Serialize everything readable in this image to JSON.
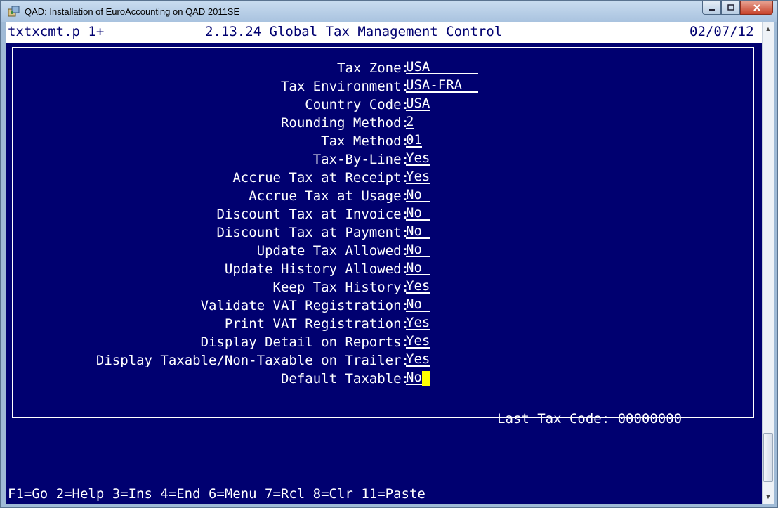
{
  "window": {
    "title": "QAD: Installation of EuroAccounting on QAD 2011SE",
    "icon": "qad-app-icon"
  },
  "header": {
    "program": "txtxcmt.p 1+",
    "menu_title": "2.13.24 Global Tax Management Control",
    "date": "02/07/12"
  },
  "fields": [
    {
      "label": "Tax Zone:",
      "value": "USA"
    },
    {
      "label": "Tax Environment:",
      "value": "USA-FRA"
    },
    {
      "label": "Country Code:",
      "value": "USA"
    },
    {
      "label": "Rounding Method:",
      "value": "2"
    },
    {
      "label": "Tax Method:",
      "value": "01"
    },
    {
      "label": "Tax-By-Line:",
      "value": "Yes"
    },
    {
      "label": "Accrue Tax at Receipt:",
      "value": "Yes"
    },
    {
      "label": "Accrue Tax at Usage:",
      "value": "No"
    },
    {
      "label": "Discount Tax at Invoice:",
      "value": "No"
    },
    {
      "label": "Discount Tax at Payment:",
      "value": "No"
    },
    {
      "label": "Update Tax Allowed:",
      "value": "No"
    },
    {
      "label": "Update History Allowed:",
      "value": "No"
    },
    {
      "label": "Keep Tax History:",
      "value": "Yes"
    },
    {
      "label": "Validate VAT Registration:",
      "value": "No"
    },
    {
      "label": "Print VAT Registration:",
      "value": "Yes"
    },
    {
      "label": "Display Detail on Reports:",
      "value": "Yes"
    },
    {
      "label": "Display Taxable/Non-Taxable on Trailer:",
      "value": "Yes"
    },
    {
      "label": "Default Taxable:",
      "value": "No"
    }
  ],
  "last_tax_code": {
    "label": "Last Tax Code:",
    "value": "00000000"
  },
  "footer": "F1=Go 2=Help 3=Ins 4=End 6=Menu 7=Rcl 8=Clr 11=Paste",
  "colors": {
    "terminal_bg": "#000070",
    "cursor": "#ffff00",
    "text": "#ffffff"
  }
}
